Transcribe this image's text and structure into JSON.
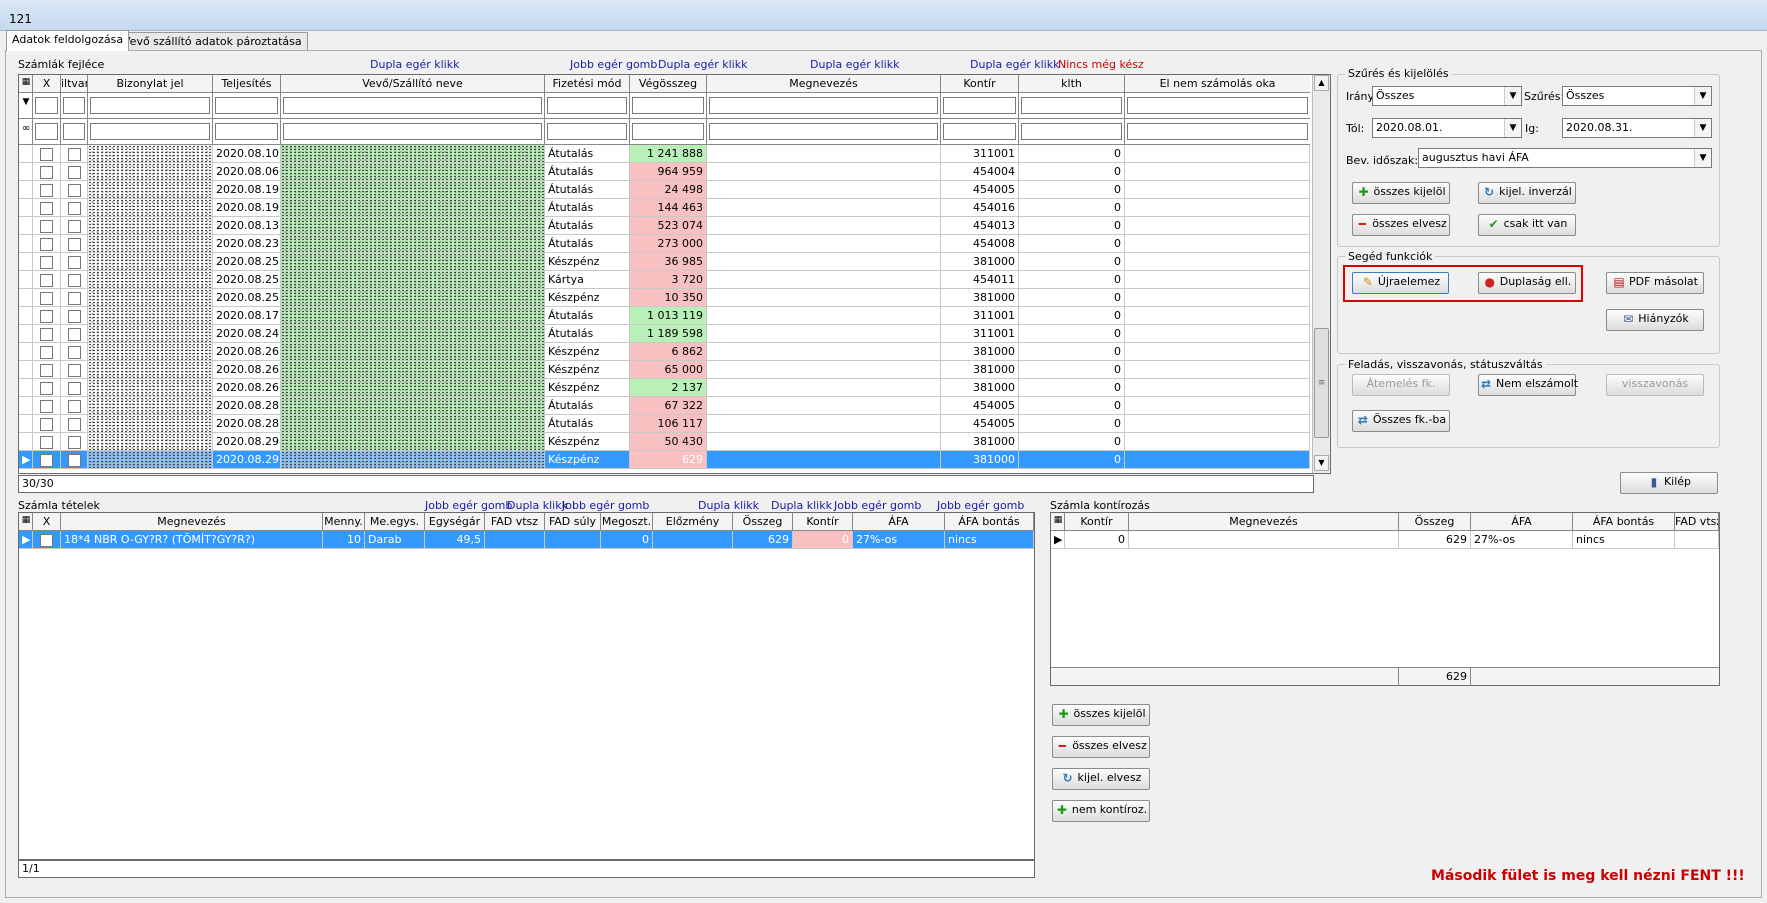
{
  "window": {
    "title": "121"
  },
  "tabs": [
    "Adatok feldolgozása",
    "Vevő szállító adatok pároztatása"
  ],
  "top_grid": {
    "caption": "Számlák fejléce",
    "hints": [
      {
        "text": "Dupla egér klikk",
        "red": false
      },
      {
        "text": "Jobb egér gomb",
        "red": false
      },
      {
        "text": "Dupla egér klikk",
        "red": false
      },
      {
        "text": "Dupla egér klikk",
        "red": false
      },
      {
        "text": "Dupla egér klikk",
        "red": false
      },
      {
        "text": "Nincs még kész",
        "red": true
      }
    ],
    "columns": [
      "X",
      "iltvan",
      "Bizonylat jel",
      "Teljesítés",
      "Vevő/Szállító neve",
      "Fizetési mód",
      "Végösszeg",
      "Megnevezés",
      "Kontír",
      "klth",
      "El nem számolás oka"
    ],
    "rows": [
      {
        "date": "2020.08.10.",
        "pay": "Átutalás",
        "amount": "1 241 888",
        "kontir": "311001",
        "klth": "0",
        "tone": "green"
      },
      {
        "date": "2020.08.06.",
        "pay": "Átutalás",
        "amount": "964 959",
        "kontir": "454004",
        "klth": "0",
        "tone": "red"
      },
      {
        "date": "2020.08.19.",
        "pay": "Átutalás",
        "amount": "24 498",
        "kontir": "454005",
        "klth": "0",
        "tone": "red"
      },
      {
        "date": "2020.08.19.",
        "pay": "Átutalás",
        "amount": "144 463",
        "kontir": "454016",
        "klth": "0",
        "tone": "red"
      },
      {
        "date": "2020.08.13.",
        "pay": "Átutalás",
        "amount": "523 074",
        "kontir": "454013",
        "klth": "0",
        "tone": "red"
      },
      {
        "date": "2020.08.23.",
        "pay": "Átutalás",
        "amount": "273 000",
        "kontir": "454008",
        "klth": "0",
        "tone": "red"
      },
      {
        "date": "2020.08.25.",
        "pay": "Készpénz",
        "amount": "36 985",
        "kontir": "381000",
        "klth": "0",
        "tone": "red"
      },
      {
        "date": "2020.08.25.",
        "pay": "Kártya",
        "amount": "3 720",
        "kontir": "454011",
        "klth": "0",
        "tone": "red"
      },
      {
        "date": "2020.08.25.",
        "pay": "Készpénz",
        "amount": "10 350",
        "kontir": "381000",
        "klth": "0",
        "tone": "red"
      },
      {
        "date": "2020.08.17.",
        "pay": "Átutalás",
        "amount": "1 013 119",
        "kontir": "311001",
        "klth": "0",
        "tone": "green"
      },
      {
        "date": "2020.08.24.",
        "pay": "Átutalás",
        "amount": "1 189 598",
        "kontir": "311001",
        "klth": "0",
        "tone": "green"
      },
      {
        "date": "2020.08.26.",
        "pay": "Készpénz",
        "amount": "6 862",
        "kontir": "381000",
        "klth": "0",
        "tone": "red"
      },
      {
        "date": "2020.08.26.",
        "pay": "Készpénz",
        "amount": "65 000",
        "kontir": "381000",
        "klth": "0",
        "tone": "red"
      },
      {
        "date": "2020.08.26.",
        "pay": "Készpénz",
        "amount": "2 137",
        "kontir": "381000",
        "klth": "0",
        "tone": "green"
      },
      {
        "date": "2020.08.28.",
        "pay": "Átutalás",
        "amount": "67 322",
        "kontir": "454005",
        "klth": "0",
        "tone": "red"
      },
      {
        "date": "2020.08.28.",
        "pay": "Átutalás",
        "amount": "106 117",
        "kontir": "454005",
        "klth": "0",
        "tone": "red"
      },
      {
        "date": "2020.08.29.",
        "pay": "Készpénz",
        "amount": "50 430",
        "kontir": "381000",
        "klth": "0",
        "tone": "red"
      },
      {
        "date": "2020.08.29.",
        "pay": "Készpénz",
        "amount": "629",
        "kontir": "381000",
        "klth": "0",
        "tone": "red",
        "selected": true
      }
    ],
    "status": "30/30"
  },
  "filter_panel": {
    "title": "Szűrés és kijelölés",
    "irany_label": "Irány:",
    "irany_value": "Összes",
    "szures_label": "Szűrés:",
    "szures_value": "Összes",
    "tol_label": "Tól:",
    "tol_value": "2020.08.01.",
    "ig_label": "Ig:",
    "ig_value": "2020.08.31.",
    "bev_label": "Bev. időszak:",
    "bev_value": "augusztus havi ÁFA",
    "btn_select_all": "összes kijelöl",
    "btn_invert": "kijel. inverzál",
    "btn_deselect_all": "összes elvesz",
    "btn_only_here": "csak itt van"
  },
  "helper_panel": {
    "title": "Segéd funkciók",
    "btn_reparse": "Újraelemez",
    "btn_duplicate": "Duplaság ell.",
    "btn_pdf": "PDF másolat",
    "btn_missing": "Hiányzók"
  },
  "status_panel": {
    "title": "Feladás, visszavonás, státuszváltás",
    "btn_transfer": "Átemelés fk.",
    "btn_not_settled": "Nem elszámolt",
    "btn_revoke": "visszavonás",
    "btn_all_fk": "Összes fk.-ba"
  },
  "exit_button": "Kilép",
  "items_grid": {
    "caption": "Számla tételek",
    "hints": [
      "Jobb egér gomb",
      "Dupla klikk",
      "Jobb egér gomb",
      "Dupla klikk",
      "Dupla klikk",
      "Jobb egér gomb",
      "Jobb egér gomb"
    ],
    "columns": [
      "X",
      "Megnevezés",
      "Menny.",
      "Me.egys.",
      "Egységár",
      "FAD vtsz",
      "FAD súly",
      "Megoszt.",
      "Előzmény",
      "Összeg",
      "Kontír",
      "ÁFA",
      "ÁFA bontás"
    ],
    "row": {
      "name": "18*4 NBR O-GY?R? (TÖMÍT?GY?R?)",
      "qty": "10",
      "unit": "Darab",
      "price": "49,5",
      "split": "0",
      "amount": "629",
      "kontir": "0",
      "vat": "27%-os",
      "vat_split": "nincs"
    },
    "status": "1/1"
  },
  "kontir_grid": {
    "caption": "Számla kontírozás",
    "columns": [
      "Kontír",
      "Megnevezés",
      "Összeg",
      "ÁFA",
      "ÁFA bontás",
      "FAD vtsz"
    ],
    "row": {
      "kontir": "0",
      "amount": "629",
      "vat": "27%-os",
      "vat_split": "nincs"
    },
    "total": "629"
  },
  "bottom_buttons": {
    "select_all": "összes kijelöl",
    "deselect_all": "összes elvesz",
    "invert_selection": "kijel. elvesz",
    "no_kontir": "nem kontíroz."
  },
  "warning": "Második fület is meg kell nézni FENT !!!",
  "colors": {
    "green": "#b8f0b8",
    "red": "#f8c0c0",
    "selected": "#3399ff",
    "warning": "#cc0000",
    "highlight_box": "#dd0000"
  }
}
